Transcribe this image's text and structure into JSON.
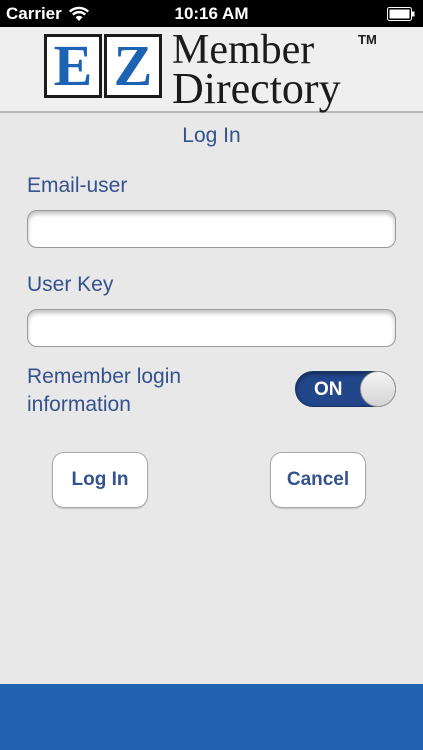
{
  "status_bar": {
    "carrier": "Carrier",
    "time": "10:16 AM"
  },
  "logo": {
    "letter_e": "E",
    "letter_z": "Z",
    "line1": "Member",
    "line2": "Directory",
    "trademark": "TM"
  },
  "form": {
    "title": "Log In",
    "email_label": "Email-user",
    "email_value": "",
    "key_label": "User Key",
    "key_value": "",
    "remember_label": "Remember login information",
    "remember_toggle_text": "ON",
    "remember_on": true
  },
  "buttons": {
    "login": "Log In",
    "cancel": "Cancel"
  },
  "colors": {
    "accent": "#34528d",
    "footer": "#2163b1",
    "logo_blue": "#1c63b4"
  }
}
